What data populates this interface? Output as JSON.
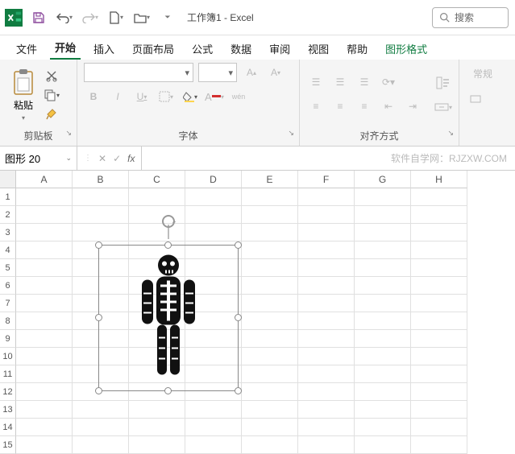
{
  "titlebar": {
    "doc_title": "工作簿1 - Excel",
    "search_placeholder": "搜索"
  },
  "tabs": {
    "file": "文件",
    "home": "开始",
    "insert": "插入",
    "layout": "页面布局",
    "formulas": "公式",
    "data": "数据",
    "review": "审阅",
    "view": "视图",
    "help": "帮助",
    "shapefmt": "图形格式"
  },
  "ribbon": {
    "clipboard": {
      "paste": "粘贴",
      "label": "剪贴板"
    },
    "font": {
      "label": "字体",
      "bold": "B",
      "italic": "I",
      "underline": "U",
      "wen": "wén"
    },
    "align": {
      "label": "对齐方式"
    },
    "styles": {
      "normal": "常规"
    }
  },
  "formula_bar": {
    "name_box": "图形 20",
    "watermark": "软件自学网：RJZXW.COM"
  },
  "columns": [
    "A",
    "B",
    "C",
    "D",
    "E",
    "F",
    "G",
    "H"
  ],
  "rows": [
    "1",
    "2",
    "3",
    "4",
    "5",
    "6",
    "7",
    "8",
    "9",
    "10",
    "11",
    "12",
    "13",
    "14",
    "15"
  ],
  "shape": {
    "icon": "skeleton-icon"
  }
}
